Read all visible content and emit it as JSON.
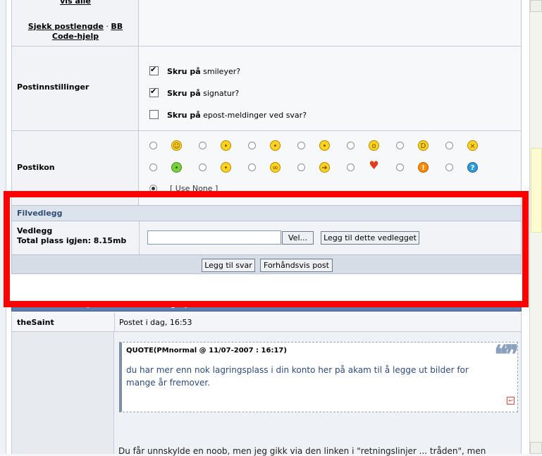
{
  "links": {
    "show_all": "vis alle",
    "check_length": "Sjekk postlengde",
    "separator": "·",
    "bb": "BB",
    "code_help": "Code-hjelp"
  },
  "post_settings": {
    "label": "Postinnstillinger",
    "options": [
      {
        "bold": "Skru på",
        "text": "smileyer?",
        "checked": true
      },
      {
        "bold": "Skru på",
        "text": "signatur?",
        "checked": true
      },
      {
        "bold": "Skru på",
        "text": "epost-meldinger ved svar?",
        "checked": false
      }
    ]
  },
  "post_icon": {
    "label": "Postikon",
    "use_none": "[ Use None ]",
    "row1_icons": [
      "smile-icon",
      "unsure-icon",
      "relieved-icon",
      "sleepy-icon",
      "grin-icon",
      "surprised-icon",
      "big-grin-icon",
      "angry-icon"
    ],
    "row2_icons": [
      "sick-icon",
      "cool-icon",
      "glasses-icon",
      "arrow-icon",
      "heart-icon",
      "warning-icon",
      "question-icon"
    ]
  },
  "attachments": {
    "header": "Filvedlegg",
    "label": "Vedlegg",
    "space_left": "Total plass igjen: 8.15mb",
    "browse_button": "Vel...",
    "add_button": "Legg til dette vedlegget"
  },
  "actions": {
    "reply_button": "Legg til svar",
    "preview_button": "Forhåndsvis post"
  },
  "posts": {
    "header": "Siste 10 Poster [ Omvendt rekkefølge ]",
    "author": "theSaint",
    "date": "Postet i dag, 16:53",
    "quote_title": "QUOTE(PMnormal @ 11/07-2007 : 16:17)",
    "quote_text": "du har mer enn nok lagringsplass i din konto her på akam til å legge ut bilder for mange år fremover.",
    "body_cut": "Du får unnskylde en noob, men jeg gikk via den linken i \"retningslinjer ... tråden\", men"
  },
  "colors": {
    "highlight_box": "#ff0000",
    "header_bg": "#dde3ec",
    "posts_header_bg": "#5b7fb0"
  }
}
